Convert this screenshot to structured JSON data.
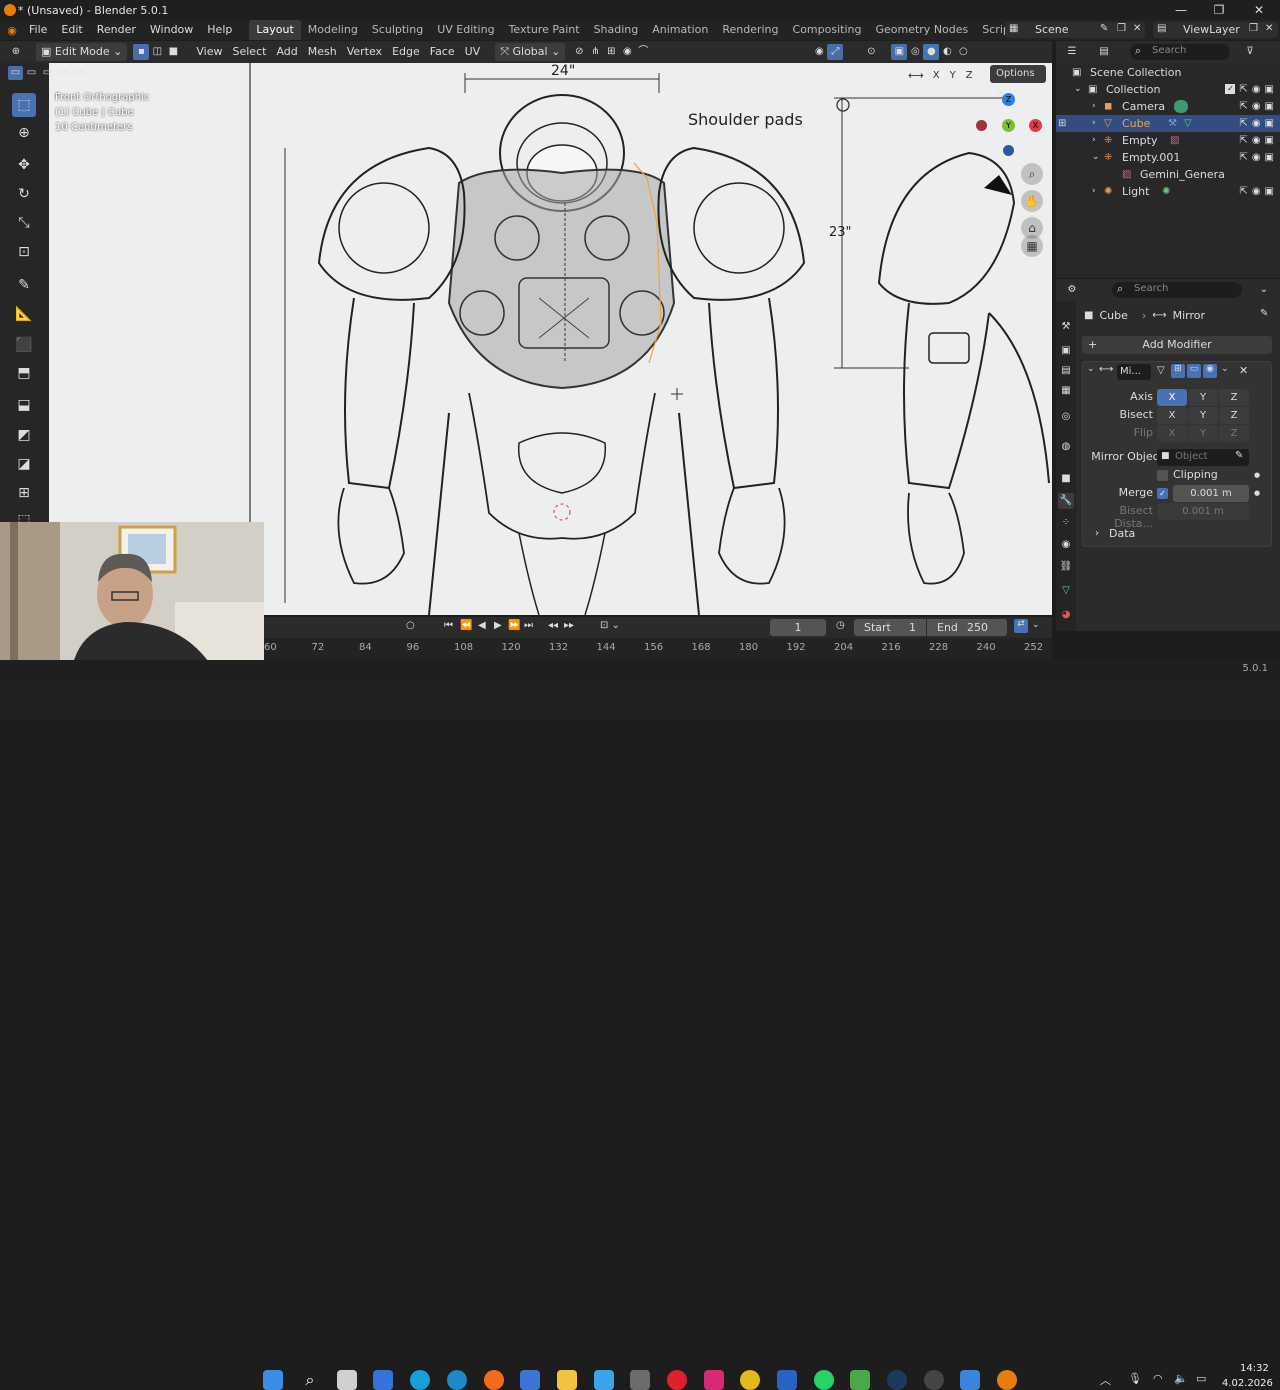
{
  "window": {
    "title": "* (Unsaved) - Blender 5.0.1",
    "min_label": "—",
    "max_label": "❐",
    "close_label": "✕"
  },
  "menu": [
    "File",
    "Edit",
    "Render",
    "Window",
    "Help"
  ],
  "workspaces": [
    "Layout",
    "Modeling",
    "Sculpting",
    "UV Editing",
    "Texture Paint",
    "Shading",
    "Animation",
    "Rendering",
    "Compositing",
    "Geometry Nodes",
    "Scripting"
  ],
  "add_workspace": "+",
  "scene": {
    "name": "Scene",
    "viewlayer": "ViewLayer"
  },
  "header3d": {
    "mode": "Edit Mode",
    "menus": [
      "View",
      "Select",
      "Add",
      "Mesh",
      "Vertex",
      "Edge",
      "Face",
      "UV"
    ],
    "orientation": "Global",
    "options": "Options",
    "axes": [
      "X",
      "Y",
      "Z"
    ]
  },
  "overlay": {
    "view": "Front Orthographic",
    "object": "(1) Cube | Cube",
    "scale": "10 Centimeters"
  },
  "drawing": {
    "label_shoulder": "Shoulder pads",
    "dim_top": "24\"",
    "dim_side": "23\""
  },
  "gizmo": {
    "z": "Z",
    "y": "Y",
    "x": "X"
  },
  "outliner": {
    "search_placeholder": "Search",
    "rows": [
      {
        "label": "Scene Collection"
      },
      {
        "label": "Collection"
      },
      {
        "label": "Camera"
      },
      {
        "label": "Cube"
      },
      {
        "label": "Empty"
      },
      {
        "label": "Empty.001"
      },
      {
        "label": "Gemini_Genera"
      },
      {
        "label": "Light"
      }
    ]
  },
  "properties": {
    "search_placeholder": "Search",
    "breadcrumb_object": "Cube",
    "breadcrumb_modifier": "Mirror",
    "add_modifier": "Add Modifier",
    "modifier_name": "Mi...",
    "axis_label": "Axis",
    "bisect_label": "Bisect",
    "flip_label": "Flip",
    "x": "X",
    "y": "Y",
    "z": "Z",
    "mirror_object_label": "Mirror Object",
    "mirror_object_placeholder": "Object",
    "clipping_label": "Clipping",
    "merge_label": "Merge",
    "merge_value": "0.001 m",
    "bisect_distance_label": "Bisect Dista...",
    "bisect_distance_value": "0.001 m",
    "data_label": "Data"
  },
  "timeline": {
    "current_frame": "1",
    "start_label": "Start",
    "start_value": "1",
    "end_label": "End",
    "end_value": "250",
    "ticks": [
      "60",
      "72",
      "84",
      "96",
      "108",
      "120",
      "132",
      "144",
      "156",
      "168",
      "180",
      "192",
      "204",
      "216",
      "228",
      "240",
      "252"
    ]
  },
  "status": {
    "version": "5.0.1"
  },
  "taskbar": {
    "time": "14:32",
    "date": "4.02.2026"
  },
  "colors": {
    "accent": "#4772b3",
    "selected_row": "#334d80",
    "orange_select": "#f2a23c",
    "viewport_bg": "#e9ebee"
  }
}
